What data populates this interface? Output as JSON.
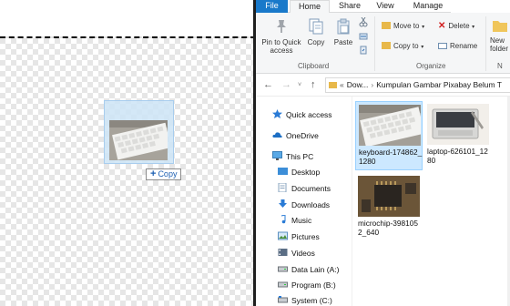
{
  "canvas": {
    "copy_badge": {
      "plus": "+",
      "label": "Copy"
    }
  },
  "ribbon_tabs": {
    "file": "File",
    "home": "Home",
    "share": "Share",
    "view": "View",
    "manage": "Manage"
  },
  "ribbon": {
    "clipboard": {
      "pin_label": "Pin to Quick\naccess",
      "copy_label": "Copy",
      "paste_label": "Paste",
      "group_label": "Clipboard"
    },
    "organize": {
      "move_to": "Move to",
      "copy_to": "Copy to",
      "delete": "Delete",
      "rename": "Rename",
      "group_label": "Organize"
    },
    "new": {
      "new_folder_label": "New\nfolder",
      "group_label": "N"
    }
  },
  "address": {
    "prefix": "«",
    "crumbs": [
      "Dow...",
      "Kumpulan Gambar Pixabay Belum T"
    ]
  },
  "nav": {
    "items": [
      {
        "label": "Quick access",
        "icon": "star-icon"
      },
      {
        "label": "OneDrive",
        "icon": "cloud-icon"
      },
      {
        "label": "This PC",
        "icon": "monitor-icon"
      },
      {
        "label": "Desktop",
        "icon": "desktop-folder-icon"
      },
      {
        "label": "Documents",
        "icon": "documents-folder-icon"
      },
      {
        "label": "Downloads",
        "icon": "downloads-folder-icon"
      },
      {
        "label": "Music",
        "icon": "music-icon"
      },
      {
        "label": "Pictures",
        "icon": "pictures-folder-icon"
      },
      {
        "label": "Videos",
        "icon": "videos-folder-icon"
      },
      {
        "label": "Data Lain (A:)",
        "icon": "drive-icon"
      },
      {
        "label": "Program (B:)",
        "icon": "drive-icon"
      },
      {
        "label": "System (C:)",
        "icon": "drive-icon"
      }
    ]
  },
  "files": [
    {
      "name": "keyboard-174862_1280",
      "selected": true
    },
    {
      "name": "laptop-626101_1280",
      "selected": false
    },
    {
      "name": "microchip-3981052_640",
      "selected": false
    }
  ],
  "colors": {
    "file_tab": "#1979ca",
    "selection": "#cce8ff",
    "copy_text": "#1c5fb2"
  }
}
